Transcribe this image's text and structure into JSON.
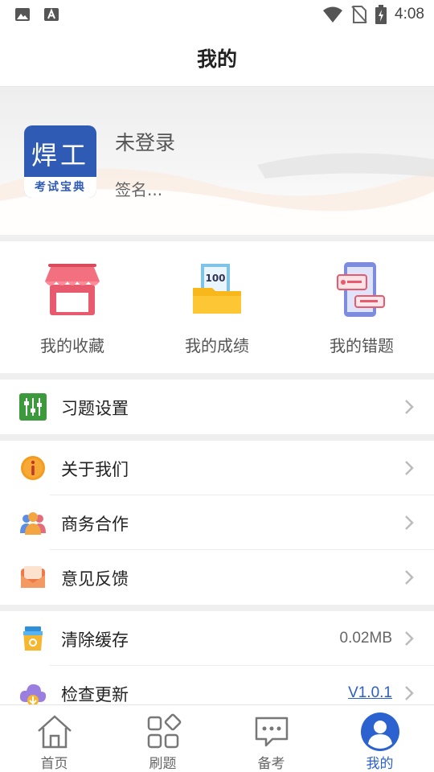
{
  "status_bar": {
    "time": "4:08"
  },
  "header": {
    "title": "我的"
  },
  "profile": {
    "app_logo": {
      "main_text": "焊工",
      "sub_text": "考试宝典"
    },
    "name": "未登录",
    "signature": "签名..."
  },
  "quick_links": [
    {
      "label": "我的收藏",
      "icon": "store-icon"
    },
    {
      "label": "我的成绩",
      "icon": "score-folder-icon",
      "badge": "100"
    },
    {
      "label": "我的错题",
      "icon": "wrong-questions-icon"
    }
  ],
  "menu": {
    "practice_settings": {
      "label": "习题设置",
      "icon": "sliders-icon"
    },
    "about_us": {
      "label": "关于我们",
      "icon": "info-icon"
    },
    "business": {
      "label": "商务合作",
      "icon": "people-icon"
    },
    "feedback": {
      "label": "意见反馈",
      "icon": "envelope-icon"
    },
    "clear_cache": {
      "label": "清除缓存",
      "value": "0.02MB",
      "icon": "cup-icon"
    },
    "check_update": {
      "label": "检查更新",
      "value": "V1.0.1",
      "icon": "cloud-download-icon"
    }
  },
  "tabs": [
    {
      "label": "首页",
      "icon": "home-icon",
      "active": false
    },
    {
      "label": "刷题",
      "icon": "grid-icon",
      "active": false
    },
    {
      "label": "备考",
      "icon": "chat-icon",
      "active": false
    },
    {
      "label": "我的",
      "icon": "user-icon",
      "active": true
    }
  ],
  "colors": {
    "accent": "#2b62d0",
    "background": "#efefef"
  }
}
